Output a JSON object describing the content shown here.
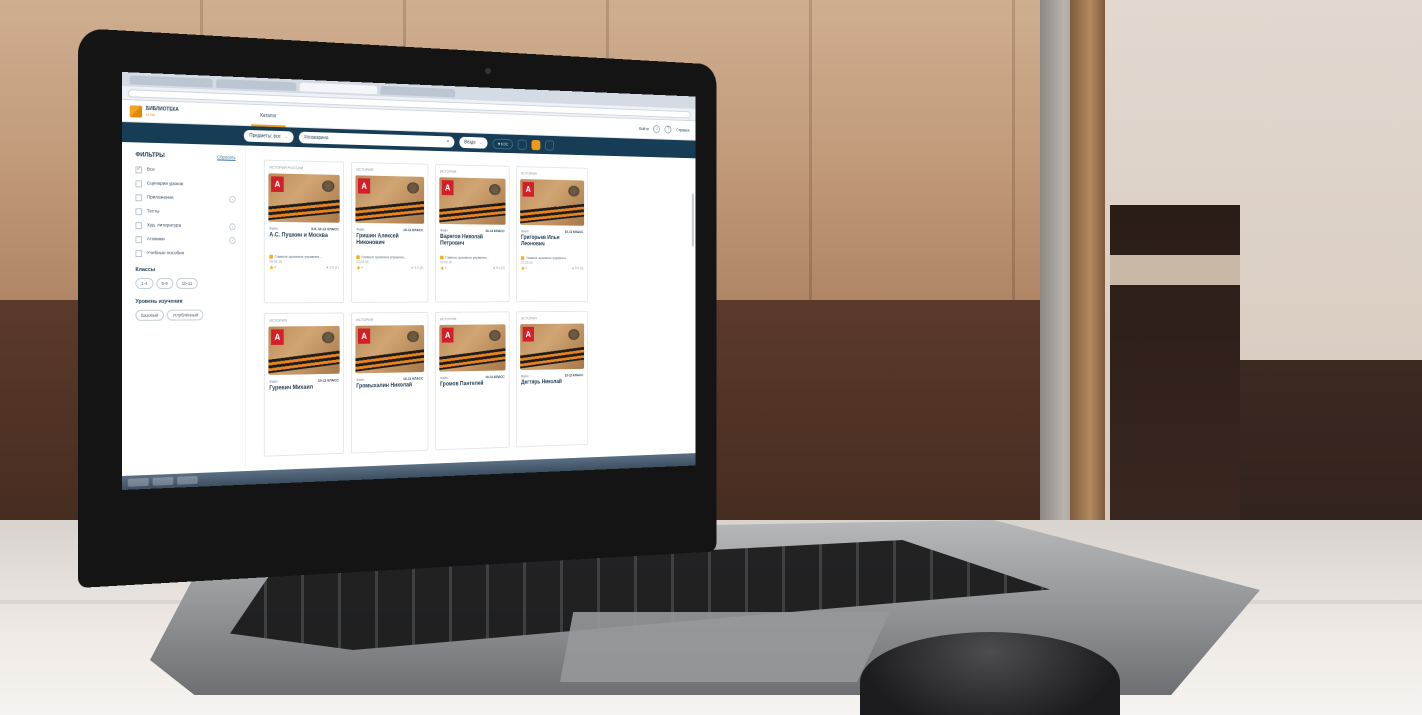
{
  "header": {
    "logo_title": "БИБЛИОТЕКА",
    "logo_sub": "МЭШ",
    "nav_tab": "Каталог",
    "login_label": "Войти",
    "help_label": "Справка"
  },
  "search": {
    "subjects_label": "Предметы: все",
    "query": "#плакарина",
    "scope_label": "Везде",
    "filter_chip": "КЭС"
  },
  "filters": {
    "title": "ФИЛЬТРЫ",
    "reset_label": "Сбросить",
    "items": [
      {
        "label": "Все",
        "checked": true,
        "has_arrow": false
      },
      {
        "label": "Сценарии уроков",
        "checked": false,
        "has_arrow": false
      },
      {
        "label": "Приложения",
        "checked": false,
        "has_arrow": true
      },
      {
        "label": "Тесты",
        "checked": false,
        "has_arrow": false
      },
      {
        "label": "Худ. литература",
        "checked": false,
        "has_arrow": true
      },
      {
        "label": "Атомики",
        "checked": false,
        "has_arrow": true
      },
      {
        "label": "Учебные пособия",
        "checked": false,
        "has_arrow": false
      }
    ],
    "classes_title": "Классы",
    "classes": [
      "1-4",
      "5-9",
      "10-11"
    ],
    "level_title": "Уровень изучения",
    "levels": [
      "Базовый",
      "Углублённый"
    ]
  },
  "cards": [
    {
      "category": "ИСТОРИЯ РОССИИ",
      "type": "Файл",
      "grades": "5-9, 10-11 КЛАСС",
      "title": "А.С. Пушкин и Москва",
      "source": "Главное архивное управлен...",
      "date": "09.03.16",
      "likes": "4",
      "rating": "5.0 (1)"
    },
    {
      "category": "ИСТОРИЯ",
      "type": "Файл",
      "grades": "10-11 КЛАСС",
      "title": "Гришин Алексей Никонович",
      "source": "Главное архивное управлен...",
      "date": "22.03.16",
      "likes": "4",
      "rating": "5.0 (2)"
    },
    {
      "category": "ИСТОРИЯ",
      "type": "Файл",
      "grades": "10-11 КЛАСС",
      "title": "Варягов Николай Петрович",
      "source": "Главное архивное управлен...",
      "date": "22.03.16",
      "likes": "3",
      "rating": "5.0 (2)"
    },
    {
      "category": "ИСТОРИЯ",
      "type": "Файл",
      "grades": "10-11 КЛАСС",
      "title": "Григорьев Илья Леонович",
      "source": "Главное архивное управлен...",
      "date": "22.03.16",
      "likes": "4",
      "rating": "5.0 (2)"
    },
    {
      "category": "ИСТОРИЯ",
      "type": "Файл",
      "grades": "10-11 КЛАСС",
      "title": "Гуревич Михаил",
      "source": "",
      "date": "",
      "likes": "",
      "rating": ""
    },
    {
      "category": "ИСТОРИЯ",
      "type": "Файл",
      "grades": "10-11 КЛАСС",
      "title": "Громыхалин Николай",
      "source": "",
      "date": "",
      "likes": "",
      "rating": ""
    },
    {
      "category": "ИСТОРИЯ",
      "type": "Файл",
      "grades": "10-11 КЛАСС",
      "title": "Громов Пантелей",
      "source": "",
      "date": "",
      "likes": "",
      "rating": ""
    },
    {
      "category": "ИСТОРИЯ",
      "type": "Файл",
      "grades": "10-11 КЛАСС",
      "title": "Дегтярь Николай",
      "source": "",
      "date": "",
      "likes": "",
      "rating": ""
    }
  ],
  "card_badge": "A",
  "colors": {
    "brand_dark": "#173d56",
    "accent": "#f09a1a",
    "badge_red": "#d21f2a"
  }
}
